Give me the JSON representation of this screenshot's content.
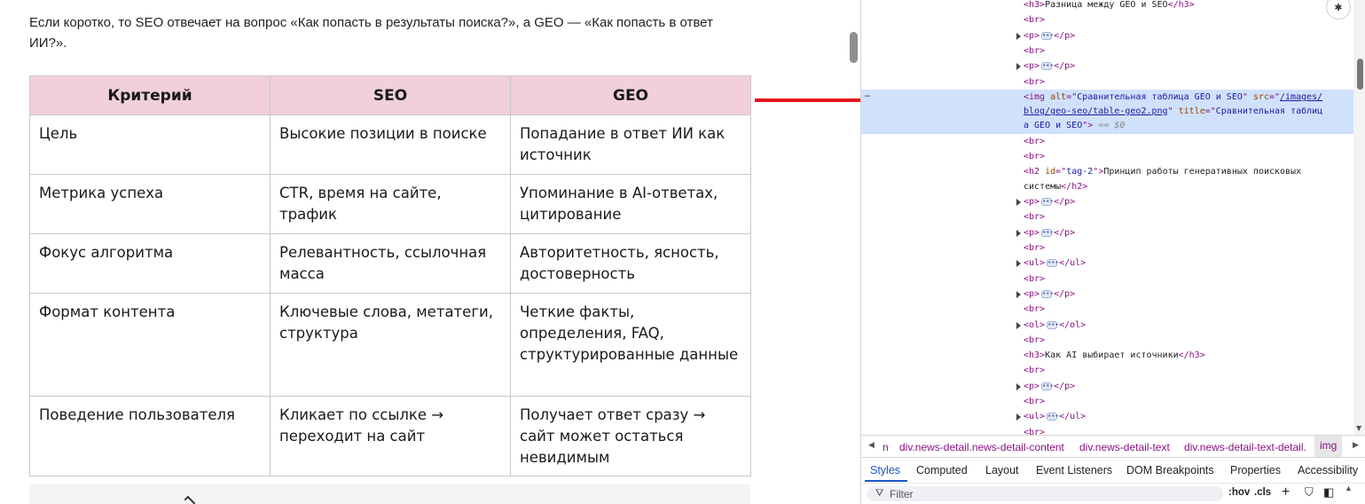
{
  "article": {
    "intro": "Если коротко, то SEO отвечает на вопрос «Как попасть в результаты поиска?», а GEO — «Как попасть в ответ ИИ?».",
    "table": {
      "headers": [
        "Критерий",
        "SEO",
        "GEO"
      ],
      "rows": [
        [
          "Цель",
          "Высокие позиции в поиске",
          "Попадание в ответ ИИ как источник"
        ],
        [
          "Метрика успеха",
          "CTR, время на сайте, трафик",
          "Упоминание в AI-ответах, цитирование"
        ],
        [
          "Фокус алгоритма",
          "Релевантность, ссылочная масса",
          "Авторитетность, ясность, достоверность"
        ],
        [
          "Формат контента",
          "Ключевые слова, метатеги, структура",
          "Четкие факты, определения, FAQ, структурированные данные"
        ],
        [
          "Поведение пользователя",
          "Кликает по ссылке → переходит на сайт",
          "Получает ответ сразу → сайт может остаться невидимым"
        ]
      ]
    }
  },
  "annotation": {
    "arrow_color": "#e8141c"
  },
  "devtools": {
    "tree": {
      "h3_1_text": "Разница между GEO и SEO",
      "img": {
        "alt_value": "Сравнительная таблица GEO и SEO",
        "src_part1": "/images/",
        "src_part2": "blog/geo-seo/table-geo2.png",
        "title_part1": "Сравнительная таблиц",
        "title_part2": "а GEO и SEO",
        "selected_marker": "== $0"
      },
      "h2_id": "tag-2",
      "h2_text_part1": "Принцип работы генеративных поисковых",
      "h2_text_part2": "системы",
      "h3_2_text": "Как AI выбирает источники"
    },
    "breadcrumbs": [
      "div.news-detail.news-detail-content",
      "div.news-detail-text",
      "div.news-detail-text-detail.",
      "img"
    ],
    "breadcrumb_cut": "n",
    "tabs": [
      "Styles",
      "Computed",
      "Layout",
      "Event Listeners",
      "DOM Breakpoints",
      "Properties",
      "Accessibility"
    ],
    "active_tab": "Styles",
    "filter_placeholder": "Filter",
    "filter_tools": [
      ":hov",
      ".cls"
    ],
    "selection_color": "#cfe1fb"
  }
}
